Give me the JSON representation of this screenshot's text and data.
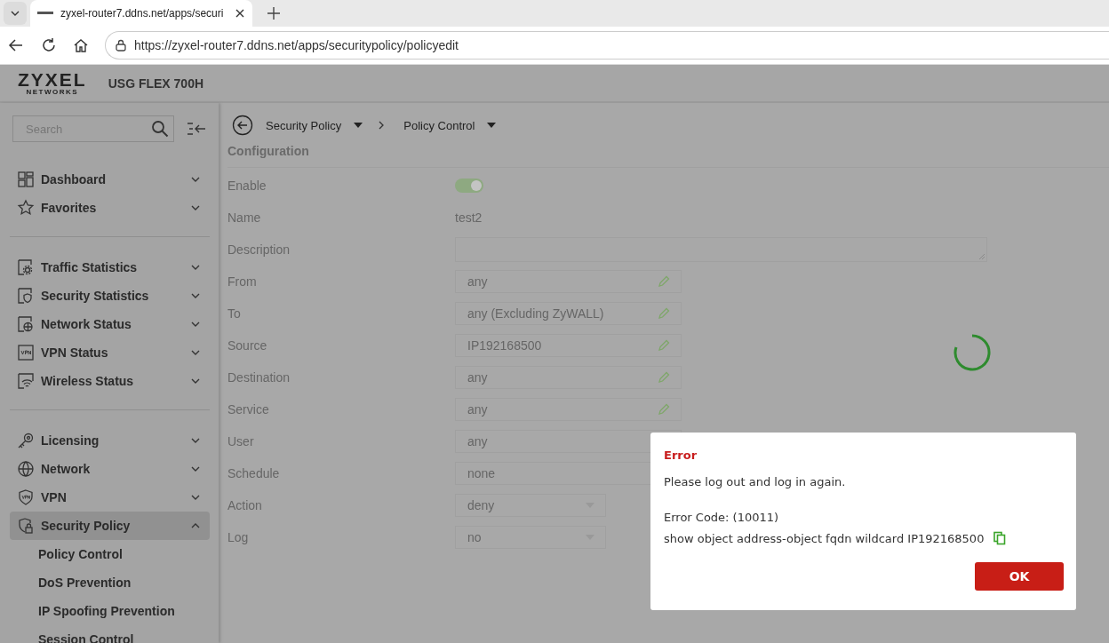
{
  "browser": {
    "tab_title": "zyxel-router7.ddns.net/apps/securi",
    "url": "https://zyxel-router7.ddns.net/apps/securitypolicy/policyedit"
  },
  "header": {
    "brand": "ZYXEL",
    "brand_sub": "NETWORKS",
    "device": "USG FLEX 700H"
  },
  "sidebar": {
    "search": {
      "placeholder": "Search"
    },
    "groups": [
      [
        {
          "label": "Dashboard",
          "expanded": false,
          "selected": false
        },
        {
          "label": "Favorites",
          "expanded": false,
          "selected": false
        }
      ],
      [
        {
          "label": "Traffic Statistics",
          "expanded": false,
          "selected": false
        },
        {
          "label": "Security Statistics",
          "expanded": false,
          "selected": false
        },
        {
          "label": "Network Status",
          "expanded": false,
          "selected": false
        },
        {
          "label": "VPN Status",
          "expanded": false,
          "selected": false
        },
        {
          "label": "Wireless Status",
          "expanded": false,
          "selected": false
        }
      ],
      [
        {
          "label": "Licensing",
          "expanded": false,
          "selected": false
        },
        {
          "label": "Network",
          "expanded": false,
          "selected": false
        },
        {
          "label": "VPN",
          "expanded": false,
          "selected": false
        },
        {
          "label": "Security Policy",
          "expanded": true,
          "selected": true,
          "children": [
            {
              "label": "Policy Control"
            },
            {
              "label": "DoS Prevention"
            },
            {
              "label": "IP Spoofing Prevention"
            },
            {
              "label": "Session Control"
            }
          ]
        }
      ]
    ]
  },
  "breadcrumb": [
    "Security Policy",
    "Policy Control"
  ],
  "section_title": "Configuration",
  "form": [
    {
      "label": "Enable",
      "kind": "toggle",
      "on": true
    },
    {
      "label": "Name",
      "kind": "text",
      "value": "test2"
    },
    {
      "label": "Description",
      "kind": "textarea"
    },
    {
      "label": "From",
      "kind": "picker",
      "value": "any"
    },
    {
      "label": "To",
      "kind": "picker",
      "value": "any (Excluding ZyWALL)"
    },
    {
      "label": "Source",
      "kind": "picker",
      "value": "IP192168500"
    },
    {
      "label": "Destination",
      "kind": "picker",
      "value": "any"
    },
    {
      "label": "Service",
      "kind": "picker",
      "value": "any"
    },
    {
      "label": "User",
      "kind": "picker",
      "value": "any"
    },
    {
      "label": "Schedule",
      "kind": "picker",
      "value": "none"
    },
    {
      "label": "Action",
      "kind": "select",
      "value": "deny"
    },
    {
      "label": "Log",
      "kind": "select",
      "value": "no"
    }
  ],
  "dialog": {
    "title": "Error",
    "message": "Please log out and log in again.",
    "code": "Error Code: (10011)",
    "detail": "show object address-object fqdn wildcard IP192168500",
    "button": "OK"
  }
}
